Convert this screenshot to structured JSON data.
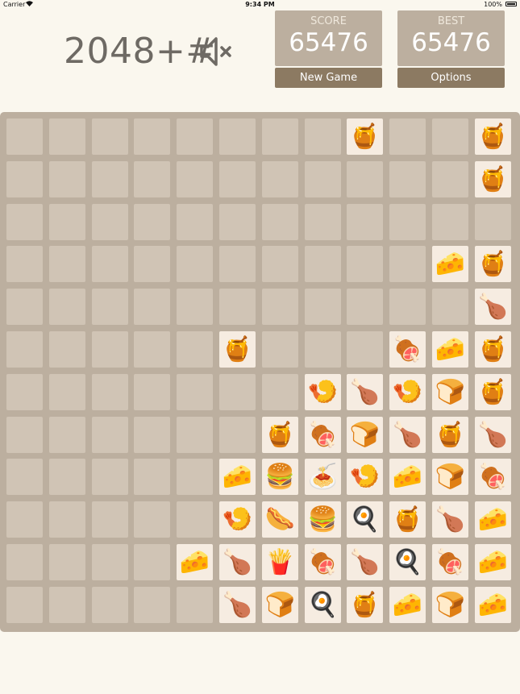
{
  "status_bar": {
    "carrier": "Carrier",
    "time": "9:34 PM",
    "battery": "100%"
  },
  "header": {
    "title": "2048+#",
    "sound_icon": "speaker-muted-icon"
  },
  "score": {
    "label": "SCORE",
    "value": "65476"
  },
  "best": {
    "label": "BEST",
    "value": "65476"
  },
  "buttons": {
    "new_game": "New Game",
    "options": "Options"
  },
  "colors": {
    "background": "#faf7ee",
    "board": "#bcaf9f",
    "empty_cell": "#d0c4b5",
    "filled_cell": "#f6ece1",
    "button": "#8c7a62",
    "score_box": "#bcaf9f",
    "title": "#6e6a64"
  },
  "board": {
    "size": 12,
    "tile_names": {
      "🍯": "honey-pot",
      "🧀": "cheese",
      "🍗": "poultry-leg",
      "🍖": "meat-on-bone",
      "🍤": "fried-shrimp",
      "🍞": "bread",
      "🍔": "hamburger",
      "🍝": "spaghetti",
      "🌭": "hot-dog",
      "🍳": "frying-pan",
      "🍟": "french-fries"
    },
    "cells": [
      [
        "",
        "",
        "",
        "",
        "",
        "",
        "",
        "",
        "🍯",
        "",
        "",
        "🍯"
      ],
      [
        "",
        "",
        "",
        "",
        "",
        "",
        "",
        "",
        "",
        "",
        "",
        "🍯"
      ],
      [
        "",
        "",
        "",
        "",
        "",
        "",
        "",
        "",
        "",
        "",
        "",
        ""
      ],
      [
        "",
        "",
        "",
        "",
        "",
        "",
        "",
        "",
        "",
        "",
        "🧀",
        "🍯"
      ],
      [
        "",
        "",
        "",
        "",
        "",
        "",
        "",
        "",
        "",
        "",
        "",
        "🍗"
      ],
      [
        "",
        "",
        "",
        "",
        "",
        "🍯",
        "",
        "",
        "",
        "🍖",
        "🧀",
        "🍯"
      ],
      [
        "",
        "",
        "",
        "",
        "",
        "",
        "",
        "🍤",
        "🍗",
        "🍤",
        "🍞",
        "🍯"
      ],
      [
        "",
        "",
        "",
        "",
        "",
        "",
        "🍯",
        "🍖",
        "🍞",
        "🍗",
        "🍯",
        "🍗"
      ],
      [
        "",
        "",
        "",
        "",
        "",
        "🧀",
        "🍔",
        "🍝",
        "🍤",
        "🧀",
        "🍞",
        "🍖"
      ],
      [
        "",
        "",
        "",
        "",
        "",
        "🍤",
        "🌭",
        "🍔",
        "🍳",
        "🍯",
        "🍗",
        "🧀"
      ],
      [
        "",
        "",
        "",
        "",
        "🧀",
        "🍗",
        "🍟",
        "🍖",
        "🍗",
        "🍳",
        "🍖",
        "🧀"
      ],
      [
        "",
        "",
        "",
        "",
        "",
        "🍗",
        "🍞",
        "🍳",
        "🍯",
        "🧀",
        "🍞",
        "🧀"
      ]
    ]
  }
}
